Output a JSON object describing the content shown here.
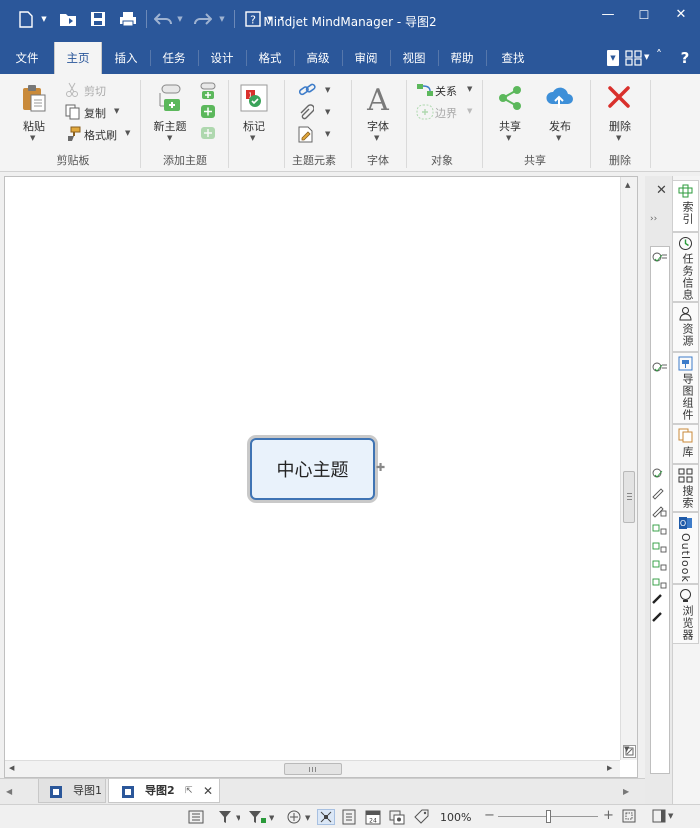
{
  "window": {
    "title": "Mindjet MindManager - 导图2",
    "controls": {
      "minimize": "—",
      "maximize": "☐",
      "close": "✕"
    }
  },
  "quick_access": {
    "icons": [
      "new-document-icon",
      "open-folder-icon",
      "save-icon",
      "print-icon",
      "undo-icon",
      "redo-icon",
      "help-icon",
      "customize-caret-icon"
    ]
  },
  "tabs": [
    {
      "label": "文件",
      "active": false
    },
    {
      "label": "主页",
      "active": true
    },
    {
      "label": "插入",
      "active": false
    },
    {
      "label": "任务",
      "active": false
    },
    {
      "label": "设计",
      "active": false
    },
    {
      "label": "格式",
      "active": false
    },
    {
      "label": "高级",
      "active": false
    },
    {
      "label": "审阅",
      "active": false
    },
    {
      "label": "视图",
      "active": false
    },
    {
      "label": "帮助",
      "active": false
    },
    {
      "label": "查找",
      "active": false
    }
  ],
  "ribbon": {
    "clipboard": {
      "label": "剪贴板",
      "paste": "粘贴",
      "cut": "剪切",
      "copy": "复制",
      "format_painter": "格式刷"
    },
    "add_topic": {
      "label": "添加主题",
      "new_topic": "新主题"
    },
    "markers": {
      "label": "标记"
    },
    "topic_elements": {
      "label": "主题元素"
    },
    "font": {
      "label": "字体",
      "font": "字体"
    },
    "objects": {
      "label": "对象",
      "relationship": "关系",
      "boundary": "边界"
    },
    "share": {
      "label": "共享",
      "share": "共享",
      "publish": "发布"
    },
    "delete": {
      "label": "删除",
      "delete": "删除"
    }
  },
  "canvas": {
    "central_topic": "中心主题"
  },
  "side_tabs": [
    "索引",
    "任务信息",
    "资源",
    "导图组件",
    "库",
    "搜索",
    "Outlook",
    "浏览器"
  ],
  "document_tabs": [
    {
      "label": "导图1",
      "active": false
    },
    {
      "label": "导图2",
      "active": true
    }
  ],
  "status": {
    "zoom": "100%"
  },
  "colors": {
    "title_bar": "#2b579a",
    "topic_border": "#3f74b4",
    "topic_fill": "#e9f2fb",
    "delete_red": "#d9302c",
    "share_green": "#5cb85c",
    "publish_blue": "#3d8fd8"
  }
}
